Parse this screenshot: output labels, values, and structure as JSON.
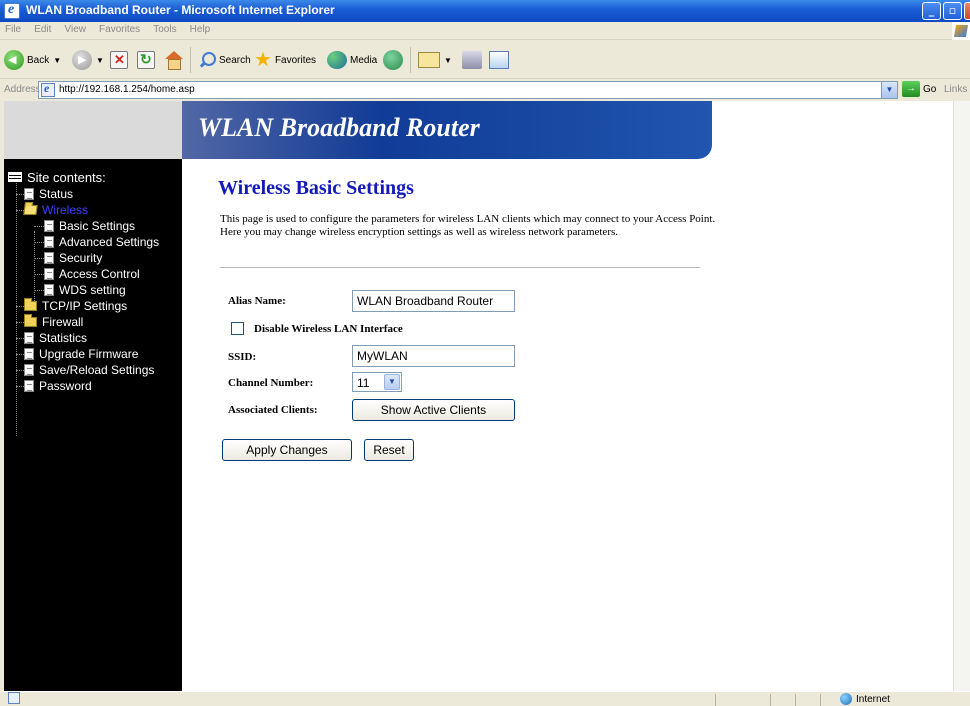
{
  "window": {
    "title": "WLAN Broadband Router - Microsoft Internet Explorer"
  },
  "menu": [
    "File",
    "Edit",
    "View",
    "Favorites",
    "Tools",
    "Help"
  ],
  "toolbar": {
    "back": "Back",
    "search": "Search",
    "favorites": "Favorites",
    "media": "Media"
  },
  "address": {
    "label": "Address",
    "url": "http://192.168.1.254/home.asp",
    "go": "Go",
    "links": "Links"
  },
  "banner": {
    "title": "WLAN Broadband Router"
  },
  "sidebar": {
    "root": "Site contents:",
    "items": [
      {
        "label": "Status",
        "icon": "doc-icon"
      },
      {
        "label": "Wireless",
        "icon": "folder-open-icon",
        "active": true
      },
      {
        "label": "Basic Settings",
        "icon": "doc-icon"
      },
      {
        "label": "Advanced Settings",
        "icon": "doc-icon"
      },
      {
        "label": "Security",
        "icon": "doc-icon"
      },
      {
        "label": "Access Control",
        "icon": "doc-icon"
      },
      {
        "label": "WDS setting",
        "icon": "doc-icon"
      },
      {
        "label": "TCP/IP Settings",
        "icon": "folder-icon"
      },
      {
        "label": "Firewall",
        "icon": "folder-icon"
      },
      {
        "label": "Statistics",
        "icon": "doc-icon"
      },
      {
        "label": "Upgrade Firmware",
        "icon": "doc-icon"
      },
      {
        "label": "Save/Reload Settings",
        "icon": "doc-icon"
      },
      {
        "label": "Password",
        "icon": "doc-icon"
      }
    ]
  },
  "page": {
    "title": "Wireless Basic Settings",
    "description": "This page is used to configure the parameters for wireless LAN clients which may connect to your Access Point. Here you may change wireless encryption settings as well as wireless network parameters.",
    "fields": {
      "alias_label": "Alias Name:",
      "alias_value": "WLAN Broadband Router",
      "disable_label": "Disable Wireless LAN Interface",
      "disable_checked": false,
      "ssid_label": "SSID:",
      "ssid_value": "MyWLAN",
      "channel_label": "Channel Number:",
      "channel_value": "11",
      "clients_label": "Associated Clients:",
      "clients_button": "Show Active Clients"
    },
    "apply_button": "Apply Changes",
    "reset_button": "Reset"
  },
  "status": {
    "zone": "Internet"
  },
  "colors": {
    "titlebar": "#0c49c2",
    "banner": "#15459e",
    "page_title": "#141ab8",
    "sidebar_bg": "#000000",
    "sidebar_active": "#4040ff"
  }
}
